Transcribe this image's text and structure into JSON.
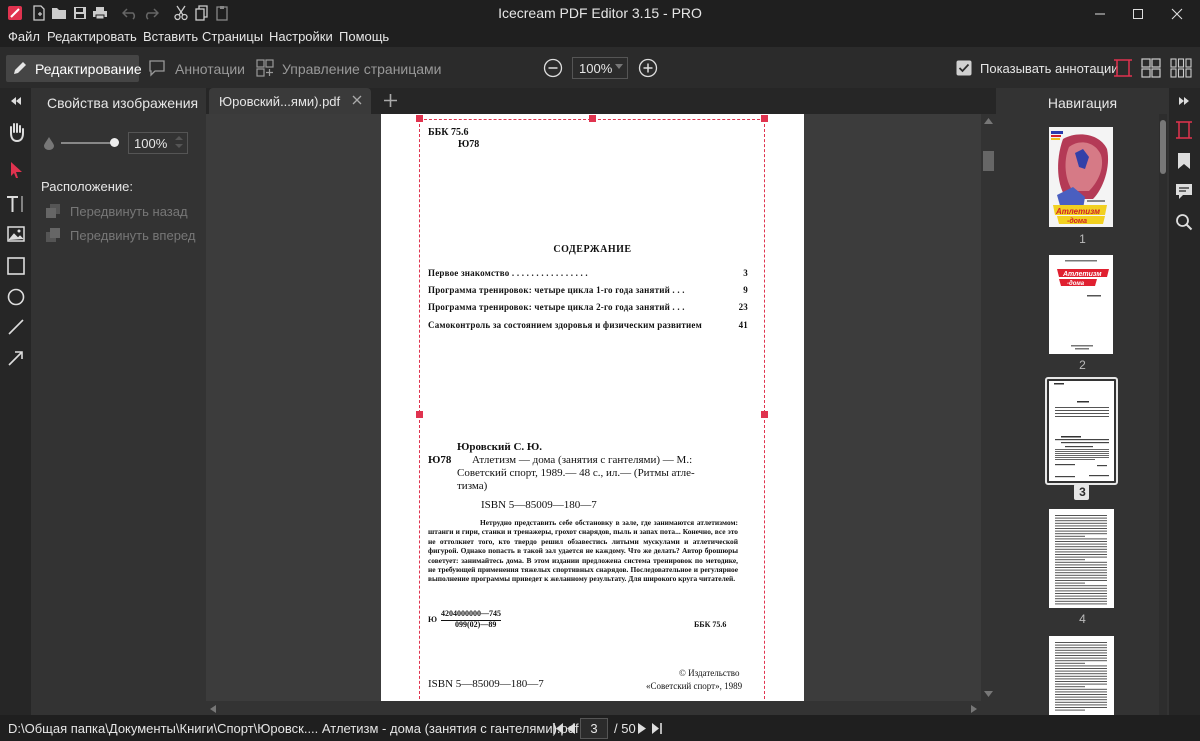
{
  "window": {
    "title": "Icecream PDF Editor 3.15 - PRO",
    "minimize": "–",
    "maximize": "☐",
    "close": "✕"
  },
  "menu": [
    "Файл",
    "Редактировать",
    "Вставить",
    "Страницы",
    "Настройки",
    "Помощь"
  ],
  "modes": {
    "edit": "Редактирование",
    "annotations": "Аннотации",
    "pages": "Управление страницами"
  },
  "zoom": {
    "value": "100%"
  },
  "show_annotations": {
    "label": "Показывать аннотации",
    "checked": true
  },
  "properties": {
    "title": "Свойства изображения",
    "opacity_value": "100%",
    "opacity_level": 1.0,
    "position_label": "Расположение:",
    "move_back": "Передвинуть назад",
    "move_forward": "Передвинуть вперед"
  },
  "tab": {
    "label": "Юровский...ями).pdf",
    "close": "✕",
    "add": "+"
  },
  "document": {
    "bbk_top": "ББК  75.6",
    "code_top": "Ю78",
    "toc_title": "СОДЕРЖАНИЕ",
    "toc": [
      {
        "text": "Первое  знакомство  .  .  .  .  .  .  .  .  .  .  .  .  .  .  .  .",
        "page": "3"
      },
      {
        "text": "Программа  тренировок:  четыре  цикла  1-го  года  занятий  .  .  .",
        "page": "9"
      },
      {
        "text": "Программа  тренировок:  четыре  цикла  2-го  года  занятий  .  .  .",
        "page": "23"
      },
      {
        "text": "Самоконтроль  за  состоянием  здоровья  и  физическим  развитием",
        "page": "41"
      }
    ],
    "author": "Юровский С. Ю.",
    "code_mid": "Ю78",
    "biblio_1": "Атлетизм — дома  (занятия  с  гантелями) — М.:",
    "biblio_2": "Советский  спорт,  1989.— 48  с.,  ил.— (Ритмы  атле-",
    "biblio_3": "тизма)",
    "isbn_mid": "ISBN  5—85009—180—7",
    "abstract": "Нетрудно представить себе обстановку в зале, где занимаются атлетизмом: штанги и гири, станки и тренажеры, грохот снарядов, пыль и запах пота... Конечно, все это не оттолкнет того, кто твердо решил обзавестись литыми мускулами и атлетической фигурой. Однако попасть в такой зал удается не каждому. Что же делать? Автор брошюры советует: занимайтесь дома. В этом издании предложена система тренировок по методике, не требующей применения тяжелых спортивных снарядов. Последовательное и регулярное выполнение программы приведет к желанному результату. Для широкого круга читателей.",
    "code_small": "Ю",
    "numer": "4204000000—745",
    "denom": "099(02)—89",
    "bbk_bottom": "ББК  75.6",
    "isbn_bottom": "ISBN  5—85009—180—7",
    "publisher_1": "©  Издательство",
    "publisher_2": "«Советский  спорт»,  1989"
  },
  "navigation": {
    "title": "Навигация",
    "pages": [
      "1",
      "2",
      "3",
      "4"
    ],
    "selected_page": 3
  },
  "status": {
    "path": "D:\\Общая папка\\Документы\\Книги\\Спорт\\Юровск.... Атлетизм - дома (занятия с гантелями).pdf",
    "current_page": "3",
    "total_pages": "/ 50"
  },
  "colors": {
    "accent": "#e0334f",
    "background": "#2b2b2b",
    "panel": "#333333"
  },
  "icons": [
    "app-logo-icon",
    "new-file-icon",
    "open-folder-icon",
    "save-icon",
    "print-icon",
    "undo-icon",
    "redo-icon",
    "cut-icon",
    "copy-icon",
    "paste-icon",
    "pencil-icon",
    "annotation-icon",
    "page-manager-icon",
    "zoom-out-icon",
    "zoom-in-icon",
    "checkbox-icon",
    "single-page-icon",
    "grid-view-icon",
    "thumbnail-grid-icon",
    "collapse-left-icon",
    "hand-icon",
    "select-arrow-icon",
    "text-tool-icon",
    "image-tool-icon",
    "rectangle-icon",
    "ellipse-icon",
    "line-icon",
    "arrow-icon",
    "opacity-icon",
    "layers-icon",
    "collapse-right-icon",
    "page-nav-icon",
    "bookmark-icon",
    "comments-icon",
    "search-icon",
    "first-page-icon",
    "prev-page-icon",
    "next-page-icon",
    "last-page-icon"
  ]
}
